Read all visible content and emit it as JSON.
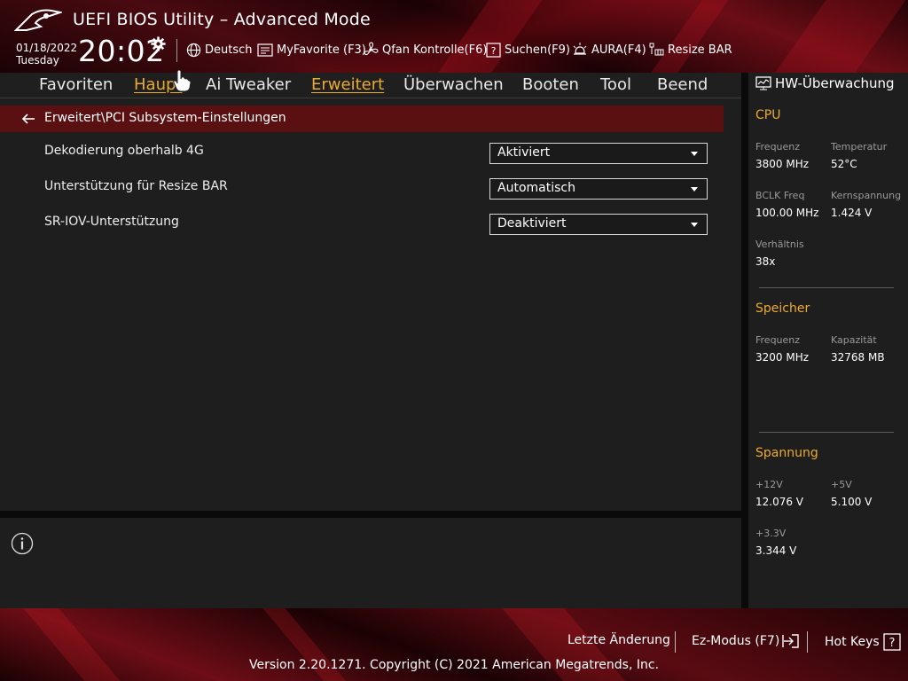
{
  "header": {
    "title": "UEFI BIOS Utility – Advanced Mode",
    "date": "01/18/2022",
    "weekday": "Tuesday",
    "time": "20:02",
    "toolbar": [
      {
        "label": "Deutsch",
        "icon": "globe-icon"
      },
      {
        "label": "MyFavorite (F3)",
        "icon": "myfavorite-icon"
      },
      {
        "label": "Qfan Kontrolle(F6)",
        "icon": "fan-icon"
      },
      {
        "label": "Suchen(F9)",
        "icon": "search-help-icon"
      },
      {
        "label": "AURA(F4)",
        "icon": "aura-icon"
      },
      {
        "label": "Resize BAR",
        "icon": "resize-bar-icon"
      }
    ]
  },
  "menu": {
    "items": [
      "Favoriten",
      "Haupt",
      "Ai Tweaker",
      "Erweitert",
      "Überwachen",
      "Booten",
      "Tool",
      "Beend"
    ],
    "active": "Erweitert",
    "hovered": "Haupt"
  },
  "main": {
    "breadcrumb": "Erweitert\\PCI Subsystem-Einstellungen",
    "settings": [
      {
        "label": "Dekodierung oberhalb 4G",
        "value": "Aktiviert"
      },
      {
        "label": "Unterstützung für Resize BAR",
        "value": "Automatisch"
      },
      {
        "label": "SR-IOV-Unterstützung",
        "value": "Deaktiviert"
      }
    ]
  },
  "hw": {
    "title": "HW-Überwachung",
    "cpu": {
      "heading": "CPU",
      "freq_label": "Frequenz",
      "freq": "3800 MHz",
      "temp_label": "Temperatur",
      "temp": "52°C",
      "bclk_label": "BCLK Freq",
      "bclk": "100.00 MHz",
      "vcore_label": "Kernspannung",
      "vcore": "1.424 V",
      "ratio_label": "Verhältnis",
      "ratio": "38x"
    },
    "memory": {
      "heading": "Speicher",
      "freq_label": "Frequenz",
      "freq": "3200 MHz",
      "cap_label": "Kapazität",
      "cap": "32768 MB"
    },
    "voltage": {
      "heading": "Spannung",
      "v12_label": "+12V",
      "v12": "12.076 V",
      "v5_label": "+5V",
      "v5": "5.100 V",
      "v33_label": "+3.3V",
      "v33": "3.344 V"
    }
  },
  "footer": {
    "last_change": "Letzte Änderung",
    "ez_mode": "Ez-Modus (F7)",
    "hot_keys": "Hot Keys",
    "copyright": "Version 2.20.1271. Copyright (C) 2021 American Megatrends, Inc."
  },
  "colors": {
    "accent": "#ecab2e",
    "breadcrumb_bg": "#5a1010",
    "panel_bg": "#1e1e1e"
  }
}
